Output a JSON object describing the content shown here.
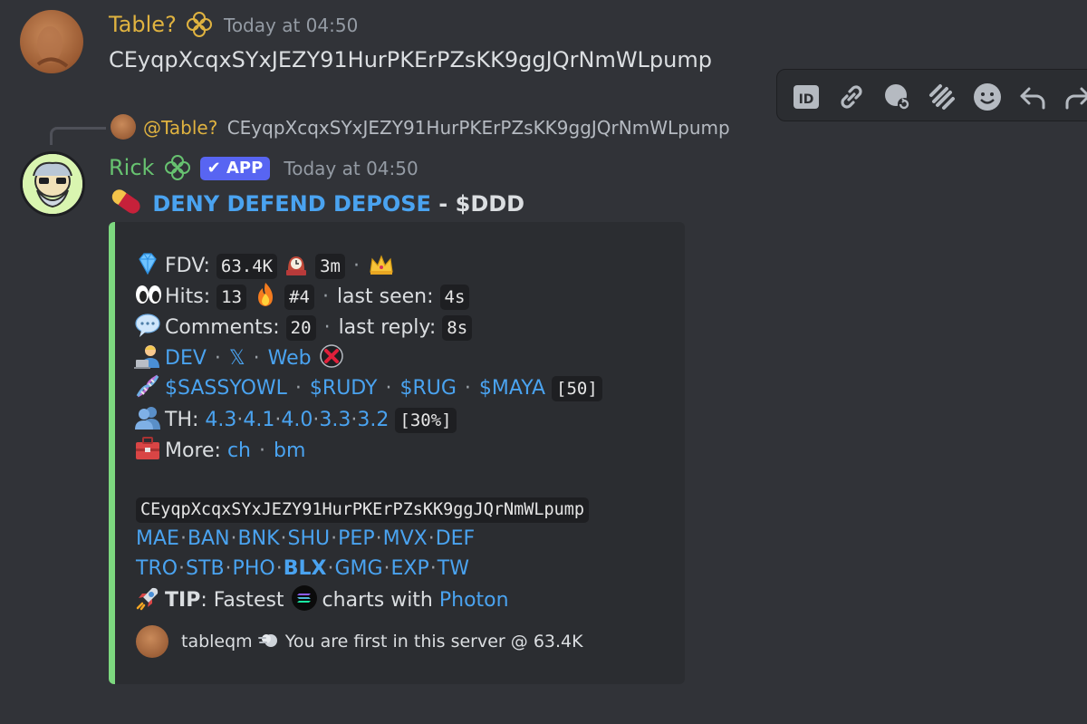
{
  "message1": {
    "username": "Table?",
    "timestamp": "Today at 04:50",
    "content": "CEyqpXcqxSYxJEZY91HurPKErPZsKK9ggJQrNmWLpump"
  },
  "reply_preview": {
    "mention": "@Table?",
    "text": "CEyqpXcqxSYxJEZY91HurPKErPZsKK9ggJQrNmWLpump"
  },
  "message2": {
    "username": "Rick",
    "app_badge": "APP",
    "timestamp": "Today at 04:50",
    "title_link": "DENY DEFEND DEPOSE",
    "title_sep": " - ",
    "title_ticker": "$DDD"
  },
  "embed": {
    "fdv_label": "FDV:",
    "fdv_value": "63.4K",
    "age_value": "3m",
    "hits_label": "Hits:",
    "hits_value": "13",
    "hits_rank": "#4",
    "last_seen_label": "last seen:",
    "last_seen_value": "4s",
    "comments_label": "Comments:",
    "comments_value": "20",
    "last_reply_label": "last reply:",
    "last_reply_value": "8s",
    "dev_link": "DEV",
    "x_link": "𝕏",
    "web_link": "Web",
    "tickers": [
      "$SASSYOWL",
      "$RUDY",
      "$RUG",
      "$MAYA"
    ],
    "tickers_count": "[50]",
    "th_label": "TH:",
    "th_values": [
      "4.3",
      "4.1",
      "4.0",
      "3.3",
      "3.2"
    ],
    "th_pct": "[30%]",
    "more_label": "More:",
    "more_links": [
      "ch",
      "bm"
    ],
    "address": "CEyqpXcqxSYxJEZY91HurPKErPZsKK9ggJQrNmWLpump",
    "row1_links": [
      "MAE",
      "BAN",
      "BNK",
      "SHU",
      "PEP",
      "MVX",
      "DEF"
    ],
    "row2_links": [
      "TRO",
      "STB",
      "PHO",
      "BLX",
      "GMG",
      "EXP",
      "TW"
    ],
    "tip_label": "TIP",
    "tip_text_1": ": Fastest ",
    "tip_text_2": " charts with ",
    "tip_link": "Photon",
    "footer_user": "tableqm",
    "footer_text": "You are first in this server @ 63.4K"
  },
  "toolbar": {
    "icons": [
      "id-icon",
      "link-icon",
      "thread-reply-icon",
      "stripes-icon",
      "emoji-icon",
      "reply-icon",
      "forward-icon"
    ]
  },
  "colors": {
    "background": "#313338",
    "embed_bg": "#2b2d31",
    "embed_accent": "#7dd87f",
    "link": "#4aa3f0",
    "username_table": "#e0b340",
    "username_rick": "#67c270",
    "app_badge": "#5865f2"
  }
}
